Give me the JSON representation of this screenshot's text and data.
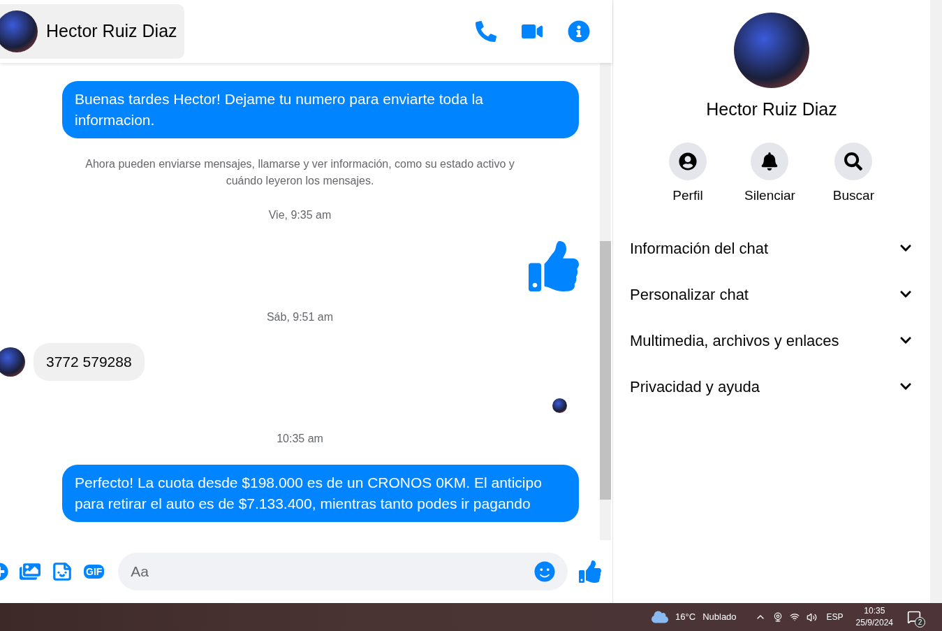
{
  "chat": {
    "contact": {
      "name": "Hector Ruiz Diaz"
    },
    "messages": [
      {
        "kind": "sent",
        "text": "Buenas tardes Hector! Dejame tu numero para enviarte toda la informacion."
      },
      {
        "kind": "notice",
        "text": "Ahora pueden enviarse mensajes, llamarse y ver información, como su estado activo y cuándo leyeron los mensajes."
      },
      {
        "kind": "timestamp",
        "text": "Vie, 9:35 am"
      },
      {
        "kind": "like"
      },
      {
        "kind": "timestamp",
        "text": "Sáb, 9:51 am"
      },
      {
        "kind": "received",
        "text": "3772 579288"
      },
      {
        "kind": "seen"
      },
      {
        "kind": "timestamp",
        "text": "10:35 am"
      },
      {
        "kind": "sent",
        "text": "Perfecto! La cuota desde $198.000 es de un CRONOS 0KM. El anticipo para retirar el auto es de $7.133.400, mientras tanto podes ir pagando"
      }
    ],
    "composer": {
      "placeholder": "Aa",
      "gif_label": "GIF"
    }
  },
  "details": {
    "name": "Hector Ruiz Diaz",
    "actions": [
      {
        "kind": "profile",
        "label": "Perfil"
      },
      {
        "kind": "mute",
        "label": "Silenciar"
      },
      {
        "kind": "search",
        "label": "Buscar"
      }
    ],
    "sections": [
      {
        "label": "Información del chat",
        "expanded": false
      },
      {
        "label": "Personalizar chat",
        "expanded": false
      },
      {
        "label": "Multimedia, archivos y enlaces",
        "expanded": false
      },
      {
        "label": "Privacidad y ayuda",
        "expanded": false
      }
    ]
  },
  "taskbar": {
    "temperature": "16°C",
    "condition": "Nublado",
    "language": "ESP",
    "time": "10:35",
    "date": "25/9/2024",
    "notifications": "2"
  }
}
